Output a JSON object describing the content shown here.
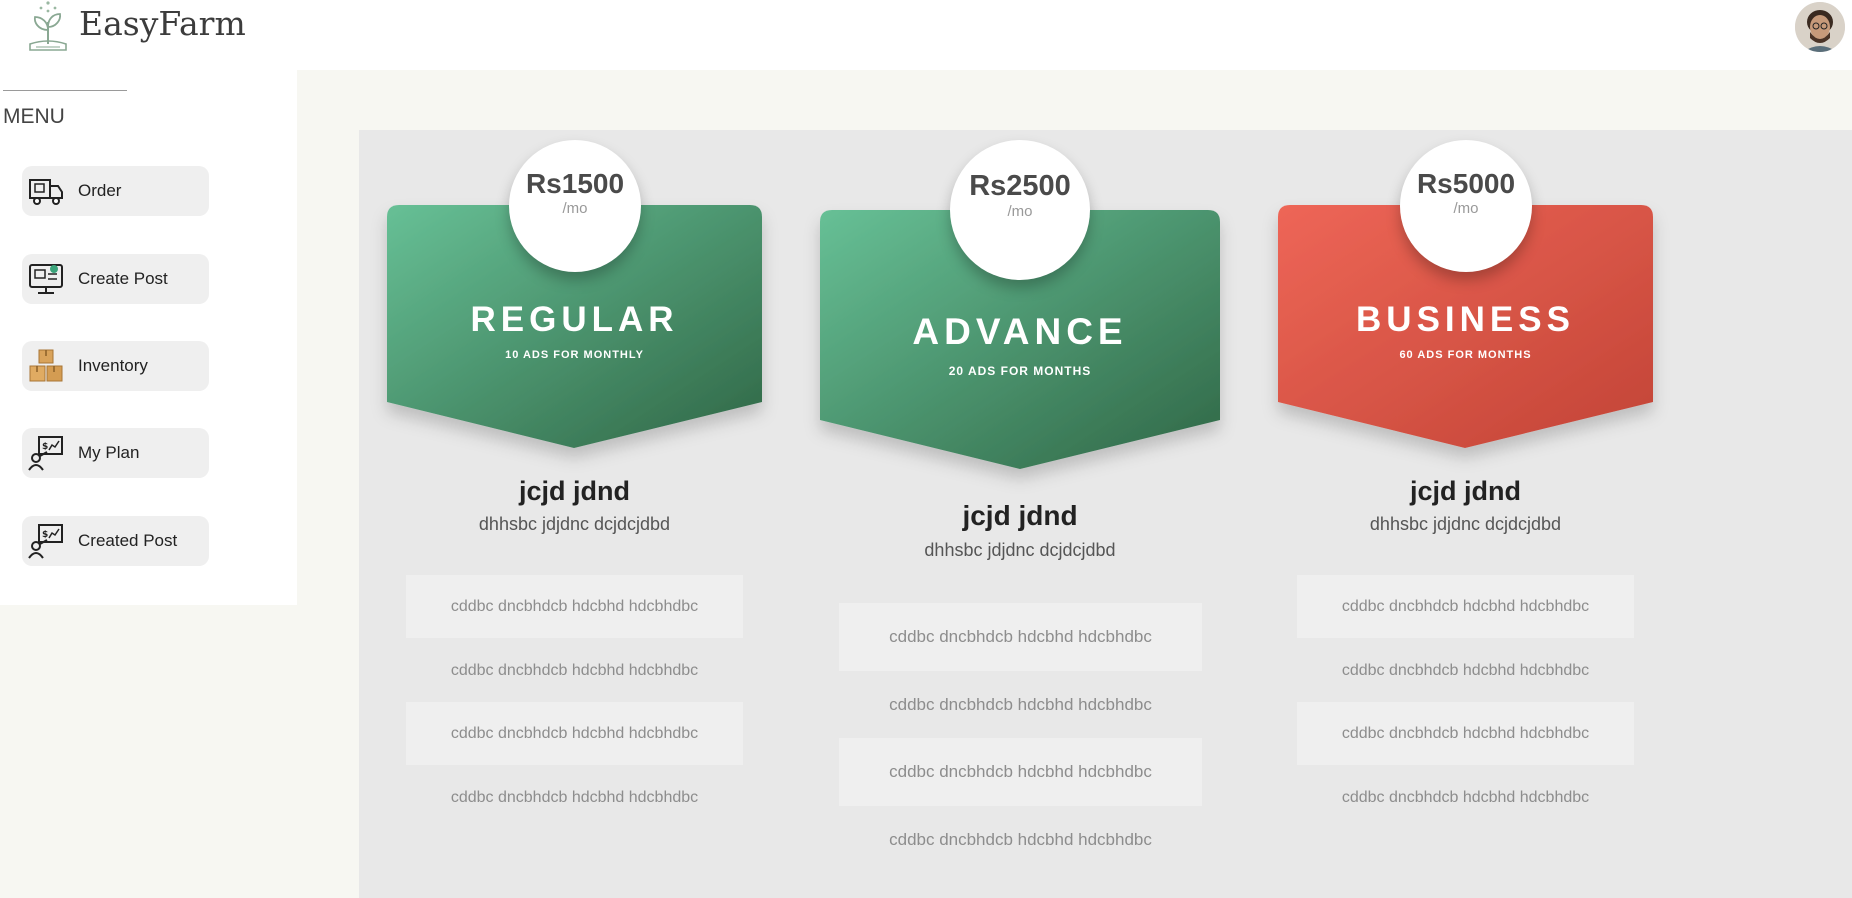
{
  "header": {
    "brand": "EasyFarm",
    "logo_icon": "seedling-logo-icon",
    "avatar_icon": "user-avatar"
  },
  "sidebar": {
    "menu_title": "MENU",
    "items": [
      {
        "label": "Order",
        "icon": "delivery-truck-icon"
      },
      {
        "label": "Create Post",
        "icon": "monitor-post-icon"
      },
      {
        "label": "Inventory",
        "icon": "boxes-icon"
      },
      {
        "label": "My Plan",
        "icon": "user-plan-icon"
      },
      {
        "label": "Created Post",
        "icon": "user-plan-icon"
      }
    ]
  },
  "plans": [
    {
      "price": "Rs1500",
      "per": "/mo",
      "name": "REGULAR",
      "subtitle": "10 ADS FOR MONTHLY",
      "title": "jcjd jdnd",
      "description": "dhhsbc jdjdnc dcjdcjdbd",
      "features": [
        "cddbc dncbhdcb hdcbhd hdcbhdbc",
        "cddbc dncbhdcb hdcbhd hdcbhdbc",
        "cddbc dncbhdcb hdcbhd hdcbhdbc",
        "cddbc dncbhdcb hdcbhd hdcbhdbc"
      ],
      "colors": {
        "from": "#67c096",
        "to": "#2f6645"
      }
    },
    {
      "price": "Rs2500",
      "per": "/mo",
      "name": "ADVANCE",
      "subtitle": "20 ADS FOR MONTHS",
      "title": "jcjd jdnd",
      "description": "dhhsbc jdjdnc dcjdcjdbd",
      "features": [
        "cddbc dncbhdcb hdcbhd hdcbhdbc",
        "cddbc dncbhdcb hdcbhd hdcbhdbc",
        "cddbc dncbhdcb hdcbhd hdcbhdbc",
        "cddbc dncbhdcb hdcbhd hdcbhdbc"
      ],
      "colors": {
        "from": "#67c096",
        "to": "#2f6645"
      }
    },
    {
      "price": "Rs5000",
      "per": "/mo",
      "name": "BUSINESS",
      "subtitle": "60 ADS FOR MONTHS",
      "title": "jcjd jdnd",
      "description": "dhhsbc jdjdnc dcjdcjdbd",
      "features": [
        "cddbc dncbhdcb hdcbhd hdcbhdbc",
        "cddbc dncbhdcb hdcbhd hdcbhdbc",
        "cddbc dncbhdcb hdcbhd hdcbhdbc",
        "cddbc dncbhdcb hdcbhd hdcbhdbc"
      ],
      "colors": {
        "from": "#ee6657",
        "to": "#c24436"
      }
    }
  ]
}
